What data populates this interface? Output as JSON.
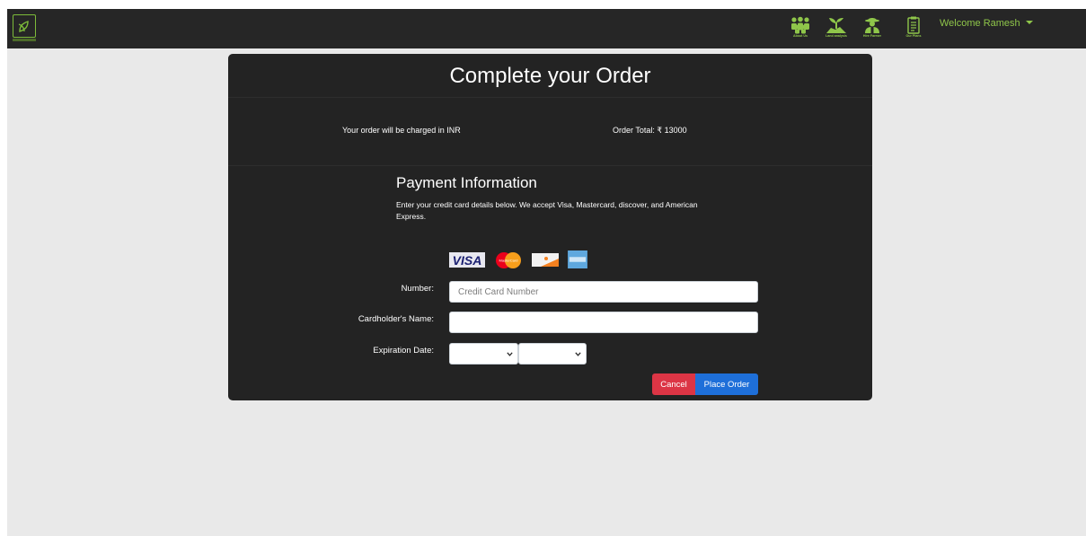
{
  "navbar": {
    "logo_icon": "leaf-logo-icon",
    "icons": [
      {
        "name": "about-us-icon",
        "caption": "About Us"
      },
      {
        "name": "land-analysis-icon",
        "caption": "Land analysis"
      },
      {
        "name": "hire-farmer-icon",
        "caption": "Hire Farmer"
      },
      {
        "name": "our-plans-icon",
        "caption": "Our Plans"
      }
    ],
    "welcome_text": "Welcome Ramesh",
    "accent_color": "#8fc64a"
  },
  "order": {
    "title": "Complete your Order",
    "charge_text": "Your order will be charged in INR",
    "total_text": "Order Total: ₹ 13000"
  },
  "payment": {
    "title": "Payment Information",
    "description": "Enter your credit card details below. We accept Visa, Mastercard, discover, and American Express.",
    "card_logos": [
      "visa",
      "mastercard",
      "discover",
      "american-express"
    ],
    "visa_text": "VISA",
    "mastercard_text": "MasterCard",
    "fields": {
      "number_label": "Number:",
      "number_placeholder": "Credit Card Number",
      "number_value": "",
      "name_label": "Cardholder's Name:",
      "name_value": "",
      "expiration_label": "Expiration Date:",
      "month_value": "",
      "year_value": ""
    },
    "buttons": {
      "cancel": "Cancel",
      "place_order": "Place Order"
    }
  }
}
